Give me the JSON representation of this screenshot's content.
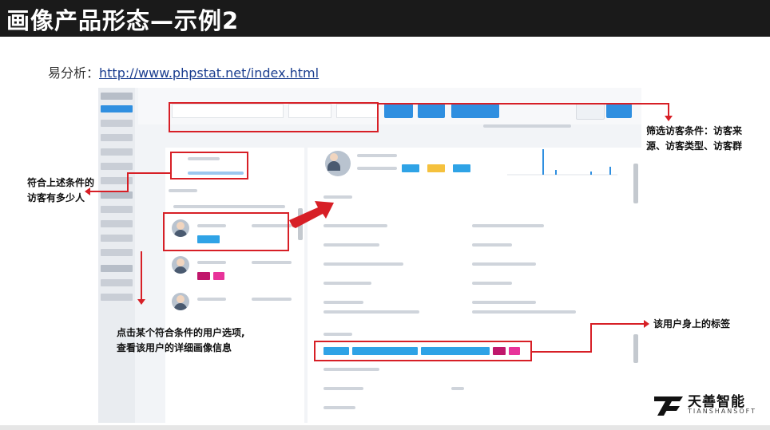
{
  "slide": {
    "title": "画像产品形态—示例2",
    "source_label": "易分析：",
    "source_url": "http://www.phpstat.net/index.html"
  },
  "annotations": {
    "filter": [
      "筛选访客条件：访客来",
      "源、访客类型、访客群"
    ],
    "count": [
      "符合上述条件的",
      "访客有多少人"
    ],
    "select_user": [
      "点击某个符合条件的用户选项,",
      "查看该用户的详细画像信息"
    ],
    "tags": "该用户身上的标签"
  },
  "logo": {
    "name_cn": "天善智能",
    "name_en": "TIANSHANSOFT"
  },
  "colors": {
    "title_bar": "#1a1a1a",
    "annotation_red": "#d71f26",
    "app_blue": "#2f8fe0",
    "tag_purple": "#c0176b",
    "tag_magenta": "#e8339a",
    "tag_cyan": "#2fa3e6"
  }
}
